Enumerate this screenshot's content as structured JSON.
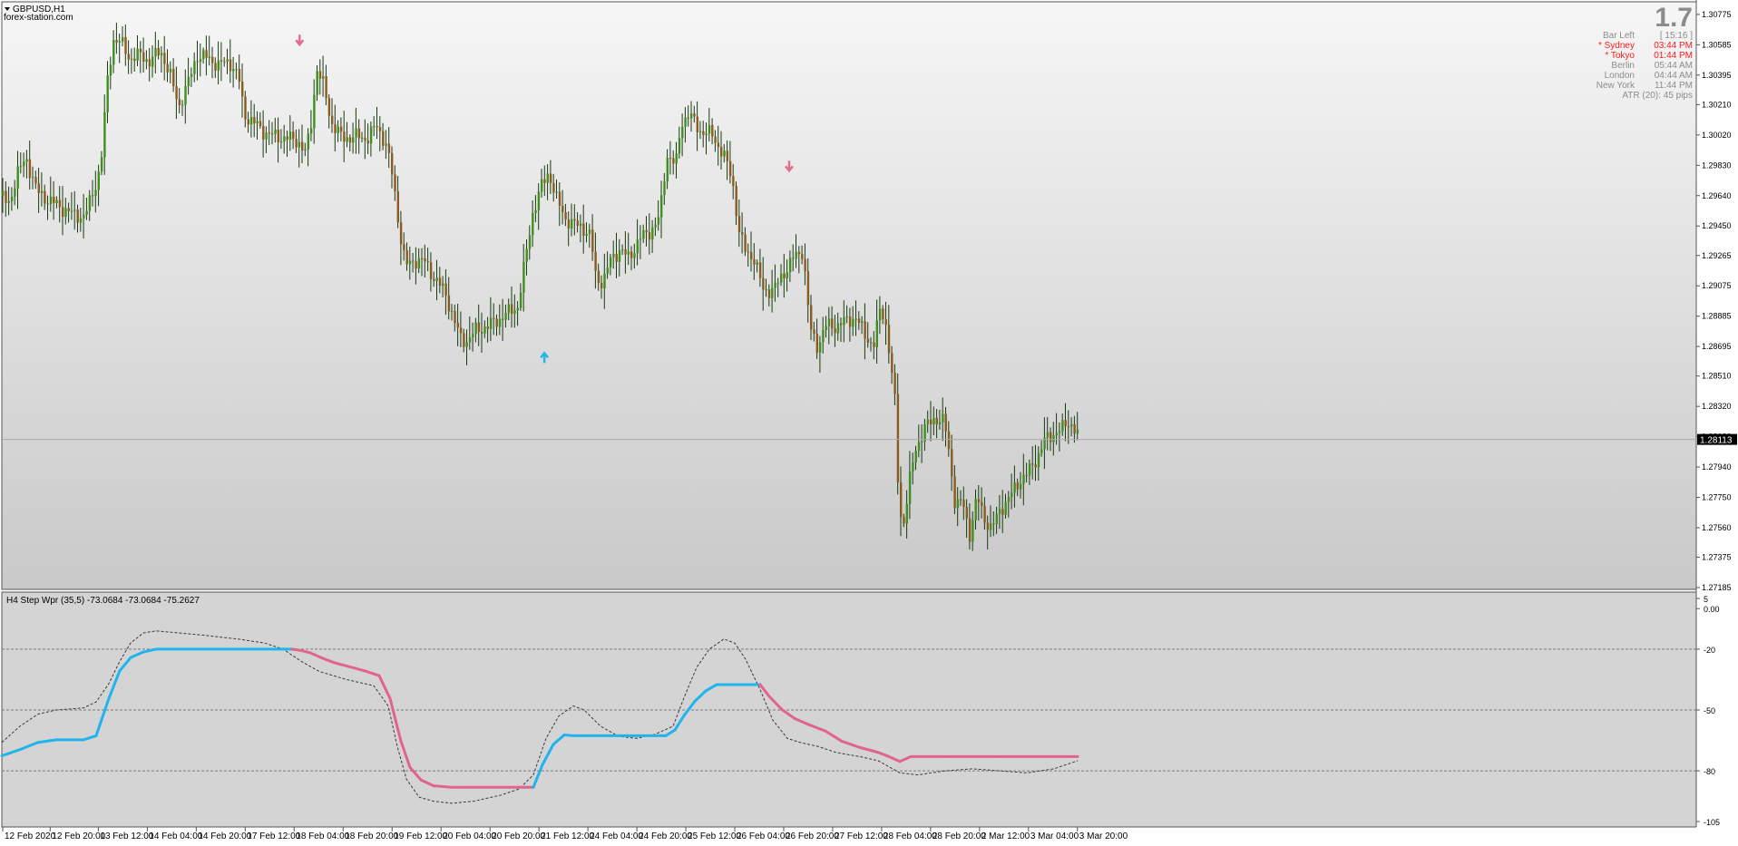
{
  "window": {
    "symbol_title": "GBPUSD,H1",
    "watermark": "forex-station.com"
  },
  "colors": {
    "bull_candle": "#3f8f1f",
    "bear_candle": "#8a5a1e",
    "up_arrow": "#1fb8e8",
    "down_arrow": "#e06f8e",
    "wpr_up": "#1fb4ee",
    "wpr_down": "#e0648c",
    "price_line_label_bg": "#000000",
    "session_active": "#ff1a1a",
    "session_inactive": "#8c8c8c"
  },
  "info_panel": {
    "spread": "1.7",
    "rows": [
      {
        "label": "Bar Left",
        "value": "[ 15:16 ]",
        "active": false
      },
      {
        "label": "* Sydney",
        "value": "03:44 PM",
        "active": true
      },
      {
        "label": "* Tokyo",
        "value": "01:44 PM",
        "active": true
      },
      {
        "label": "Berlin",
        "value": "05:44 AM",
        "active": false
      },
      {
        "label": "London",
        "value": "04:44 AM",
        "active": false
      },
      {
        "label": "New York",
        "value": "11:44 PM",
        "active": false
      }
    ],
    "atr_text": "ATR (20): 45 pips"
  },
  "indicator": {
    "title": "H4 Step Wpr (35,5) -73.0684 -73.0684 -75.2627"
  },
  "chart_data": [
    {
      "type": "candlestick",
      "symbol": "GBPUSD",
      "timeframe": "H1",
      "x_labels": [
        "12 Feb 2020",
        "12 Feb 20:00",
        "13 Feb 12:00",
        "14 Feb 04:00",
        "14 Feb 20:00",
        "17 Feb 12:00",
        "18 Feb 04:00",
        "18 Feb 20:00",
        "19 Feb 12:00",
        "20 Feb 04:00",
        "20 Feb 20:00",
        "21 Feb 12:00",
        "24 Feb 04:00",
        "24 Feb 20:00",
        "25 Feb 12:00",
        "26 Feb 04:00",
        "26 Feb 20:00",
        "27 Feb 12:00",
        "28 Feb 04:00",
        "28 Feb 20:00",
        "2 Mar 12:00",
        "3 Mar 04:00",
        "3 Mar 20:00"
      ],
      "y_ticks": [
        1.30775,
        1.30585,
        1.30395,
        1.3021,
        1.3002,
        1.2983,
        1.2964,
        1.2945,
        1.29265,
        1.29075,
        1.28885,
        1.28695,
        1.2851,
        1.2832,
        1.2813,
        1.2794,
        1.2775,
        1.2756,
        1.27375,
        1.27185
      ],
      "ylim": [
        1.27185,
        1.3082
      ],
      "current_price": 1.28113,
      "path_anchors": [
        [
          0,
          1.2964
        ],
        [
          8,
          1.2958
        ],
        [
          18,
          1.2978
        ],
        [
          28,
          1.2987
        ],
        [
          40,
          1.2966
        ],
        [
          56,
          1.296
        ],
        [
          68,
          1.2956
        ],
        [
          80,
          1.2952
        ],
        [
          92,
          1.2951
        ],
        [
          100,
          1.2963
        ],
        [
          110,
          1.2983
        ],
        [
          118,
          1.304
        ],
        [
          124,
          1.3062
        ],
        [
          132,
          1.306
        ],
        [
          142,
          1.305
        ],
        [
          154,
          1.3052
        ],
        [
          164,
          1.3048
        ],
        [
          176,
          1.3055
        ],
        [
          186,
          1.304
        ],
        [
          196,
          1.302
        ],
        [
          206,
          1.3034
        ],
        [
          216,
          1.3052
        ],
        [
          228,
          1.305
        ],
        [
          240,
          1.3046
        ],
        [
          252,
          1.3048
        ],
        [
          262,
          1.3038
        ],
        [
          268,
          1.3015
        ],
        [
          278,
          1.301
        ],
        [
          290,
          1.3004
        ],
        [
          302,
          1.3001
        ],
        [
          316,
          1.3
        ],
        [
          328,
          1.2998
        ],
        [
          336,
          1.299
        ],
        [
          342,
          1.301
        ],
        [
          348,
          1.3044
        ],
        [
          356,
          1.3032
        ],
        [
          364,
          1.301
        ],
        [
          376,
          1.3
        ],
        [
          390,
          1.3001
        ],
        [
          404,
          1.3
        ],
        [
          414,
          1.3008
        ],
        [
          424,
          1.2997
        ],
        [
          432,
          1.2975
        ],
        [
          440,
          1.294
        ],
        [
          446,
          1.292
        ],
        [
          458,
          1.2924
        ],
        [
          468,
          1.2922
        ],
        [
          478,
          1.2912
        ],
        [
          490,
          1.2903
        ],
        [
          500,
          1.2885
        ],
        [
          506,
          1.2875
        ],
        [
          514,
          1.2873
        ],
        [
          524,
          1.288
        ],
        [
          536,
          1.2882
        ],
        [
          550,
          1.2887
        ],
        [
          560,
          1.2891
        ],
        [
          570,
          1.2895
        ],
        [
          578,
          1.2924
        ],
        [
          586,
          1.2953
        ],
        [
          596,
          1.297
        ],
        [
          604,
          1.2979
        ],
        [
          612,
          1.2962
        ],
        [
          622,
          1.295
        ],
        [
          630,
          1.2946
        ],
        [
          640,
          1.2945
        ],
        [
          650,
          1.2938
        ],
        [
          656,
          1.2912
        ],
        [
          664,
          1.291
        ],
        [
          672,
          1.2924
        ],
        [
          682,
          1.293
        ],
        [
          692,
          1.2925
        ],
        [
          704,
          1.2937
        ],
        [
          716,
          1.2942
        ],
        [
          726,
          1.295
        ],
        [
          734,
          1.299
        ],
        [
          744,
          1.2983
        ],
        [
          750,
          1.301
        ],
        [
          758,
          1.3015
        ],
        [
          770,
          1.3005
        ],
        [
          784,
          1.3002
        ],
        [
          796,
          1.299
        ],
        [
          806,
          1.2975
        ],
        [
          814,
          1.294
        ],
        [
          820,
          1.293
        ],
        [
          830,
          1.2925
        ],
        [
          840,
          1.2905
        ],
        [
          852,
          1.2905
        ],
        [
          862,
          1.2915
        ],
        [
          874,
          1.2925
        ],
        [
          884,
          1.293
        ],
        [
          892,
          1.288
        ],
        [
          900,
          1.287
        ],
        [
          910,
          1.2883
        ],
        [
          920,
          1.2882
        ],
        [
          930,
          1.2885
        ],
        [
          942,
          1.2888
        ],
        [
          952,
          1.2877
        ],
        [
          962,
          1.287
        ],
        [
          970,
          1.2895
        ],
        [
          976,
          1.2882
        ],
        [
          986,
          1.2832
        ],
        [
          990,
          1.2765
        ],
        [
          996,
          1.276
        ],
        [
          1000,
          1.278
        ],
        [
          1008,
          1.2805
        ],
        [
          1018,
          1.2818
        ],
        [
          1030,
          1.2825
        ],
        [
          1040,
          1.2822
        ],
        [
          1046,
          1.28
        ],
        [
          1052,
          1.277
        ],
        [
          1060,
          1.2772
        ],
        [
          1068,
          1.2752
        ],
        [
          1076,
          1.2775
        ],
        [
          1084,
          1.2762
        ],
        [
          1092,
          1.2755
        ],
        [
          1102,
          1.2768
        ],
        [
          1112,
          1.2775
        ],
        [
          1122,
          1.2785
        ],
        [
          1132,
          1.279
        ],
        [
          1142,
          1.28
        ],
        [
          1150,
          1.281
        ],
        [
          1160,
          1.2815
        ],
        [
          1170,
          1.2818
        ],
        [
          1178,
          1.2823
        ],
        [
          1186,
          1.2815
        ],
        [
          1189,
          1.2811
        ]
      ],
      "signal_arrows": [
        {
          "direction": "down",
          "x_label": "18 Feb 04:00",
          "price": 1.3062
        },
        {
          "direction": "up",
          "x_label": "21 Feb 12:00",
          "price": 1.2862
        },
        {
          "direction": "down",
          "x_label": "26 Feb 20:00",
          "price": 1.2983
        }
      ],
      "grid": false
    },
    {
      "type": "line",
      "title": "H4 Step Wpr (35,5) -73.0684 -73.0684 -75.2627",
      "y_ticks": [
        5,
        0,
        -20,
        -50,
        -80,
        -105
      ],
      "y_tick_labels": [
        "5",
        "0.00",
        "-20",
        "-50",
        "-80",
        "-105"
      ],
      "ylim": [
        -105,
        5
      ],
      "levels": [
        -20,
        -50,
        -80
      ],
      "series": [
        {
          "role": "wpr-step",
          "points": [
            [
              0,
              -72.6
            ],
            [
              20,
              -69.5
            ],
            [
              40,
              -66.0
            ],
            [
              60,
              -64.7
            ],
            [
              90,
              -64.7
            ],
            [
              104,
              -62.7
            ],
            [
              118,
              -44.3
            ],
            [
              130,
              -30.7
            ],
            [
              142,
              -24.2
            ],
            [
              156,
              -21.4
            ],
            [
              170,
              -20.0
            ],
            [
              320,
              -20.0
            ],
            [
              330,
              -20.7
            ],
            [
              340,
              -21.8
            ],
            [
              352,
              -24.2
            ],
            [
              366,
              -26.6
            ],
            [
              380,
              -28.3
            ],
            [
              400,
              -30.7
            ],
            [
              416,
              -33.1
            ],
            [
              428,
              -44.3
            ],
            [
              440,
              -65.4
            ],
            [
              450,
              -78.3
            ],
            [
              462,
              -84.5
            ],
            [
              476,
              -87.4
            ],
            [
              496,
              -88.1
            ],
            [
              570,
              -88.1
            ],
            [
              586,
              -88.1
            ],
            [
              596,
              -77.0
            ],
            [
              608,
              -67.0
            ],
            [
              620,
              -62.3
            ],
            [
              630,
              -62.7
            ],
            [
              640,
              -62.7
            ],
            [
              732,
              -62.7
            ],
            [
              742,
              -59.9
            ],
            [
              752,
              -52.8
            ],
            [
              764,
              -45.7
            ],
            [
              776,
              -40.6
            ],
            [
              788,
              -37.5
            ],
            [
              796,
              -37.5
            ],
            [
              836,
              -37.5
            ],
            [
              846,
              -43.3
            ],
            [
              860,
              -49.8
            ],
            [
              874,
              -54.2
            ],
            [
              890,
              -57.3
            ],
            [
              908,
              -60.4
            ],
            [
              926,
              -65.4
            ],
            [
              946,
              -68.5
            ],
            [
              966,
              -70.9
            ],
            [
              976,
              -72.6
            ],
            [
              990,
              -75.4
            ],
            [
              1002,
              -73.0
            ],
            [
              1040,
              -73.0
            ],
            [
              1100,
              -73.0
            ],
            [
              1186,
              -73.0
            ]
          ]
        },
        {
          "role": "wpr-raw",
          "points": [
            [
              0,
              -66
            ],
            [
              20,
              -58
            ],
            [
              40,
              -52
            ],
            [
              60,
              -50
            ],
            [
              90,
              -49
            ],
            [
              104,
              -46
            ],
            [
              118,
              -37
            ],
            [
              130,
              -26
            ],
            [
              142,
              -17
            ],
            [
              156,
              -12
            ],
            [
              170,
              -11
            ],
            [
              220,
              -13
            ],
            [
              260,
              -15
            ],
            [
              290,
              -17
            ],
            [
              310,
              -20
            ],
            [
              330,
              -26
            ],
            [
              350,
              -31
            ],
            [
              380,
              -35
            ],
            [
              410,
              -38
            ],
            [
              426,
              -48
            ],
            [
              436,
              -68
            ],
            [
              446,
              -84
            ],
            [
              460,
              -93
            ],
            [
              476,
              -95
            ],
            [
              496,
              -96
            ],
            [
              520,
              -95
            ],
            [
              550,
              -92
            ],
            [
              570,
              -89
            ],
            [
              586,
              -82
            ],
            [
              600,
              -64
            ],
            [
              614,
              -53
            ],
            [
              630,
              -48
            ],
            [
              642,
              -50
            ],
            [
              660,
              -58
            ],
            [
              680,
              -63
            ],
            [
              700,
              -64
            ],
            [
              720,
              -62
            ],
            [
              740,
              -58
            ],
            [
              752,
              -44
            ],
            [
              766,
              -29
            ],
            [
              780,
              -20
            ],
            [
              796,
              -15
            ],
            [
              808,
              -17
            ],
            [
              820,
              -25
            ],
            [
              836,
              -40
            ],
            [
              850,
              -55
            ],
            [
              866,
              -64
            ],
            [
              880,
              -66
            ],
            [
              900,
              -68
            ],
            [
              920,
              -71
            ],
            [
              946,
              -73
            ],
            [
              966,
              -75
            ],
            [
              990,
              -81
            ],
            [
              1010,
              -82
            ],
            [
              1040,
              -80
            ],
            [
              1070,
              -79
            ],
            [
              1100,
              -80
            ],
            [
              1130,
              -81
            ],
            [
              1160,
              -79
            ],
            [
              1186,
              -75
            ]
          ]
        }
      ],
      "step_switch_points": [
        {
          "from": "up",
          "to": "down",
          "at_x": 320
        },
        {
          "from": "down",
          "to": "up",
          "at_x": 586
        },
        {
          "from": "up",
          "to": "down",
          "at_x": 836
        }
      ]
    }
  ]
}
